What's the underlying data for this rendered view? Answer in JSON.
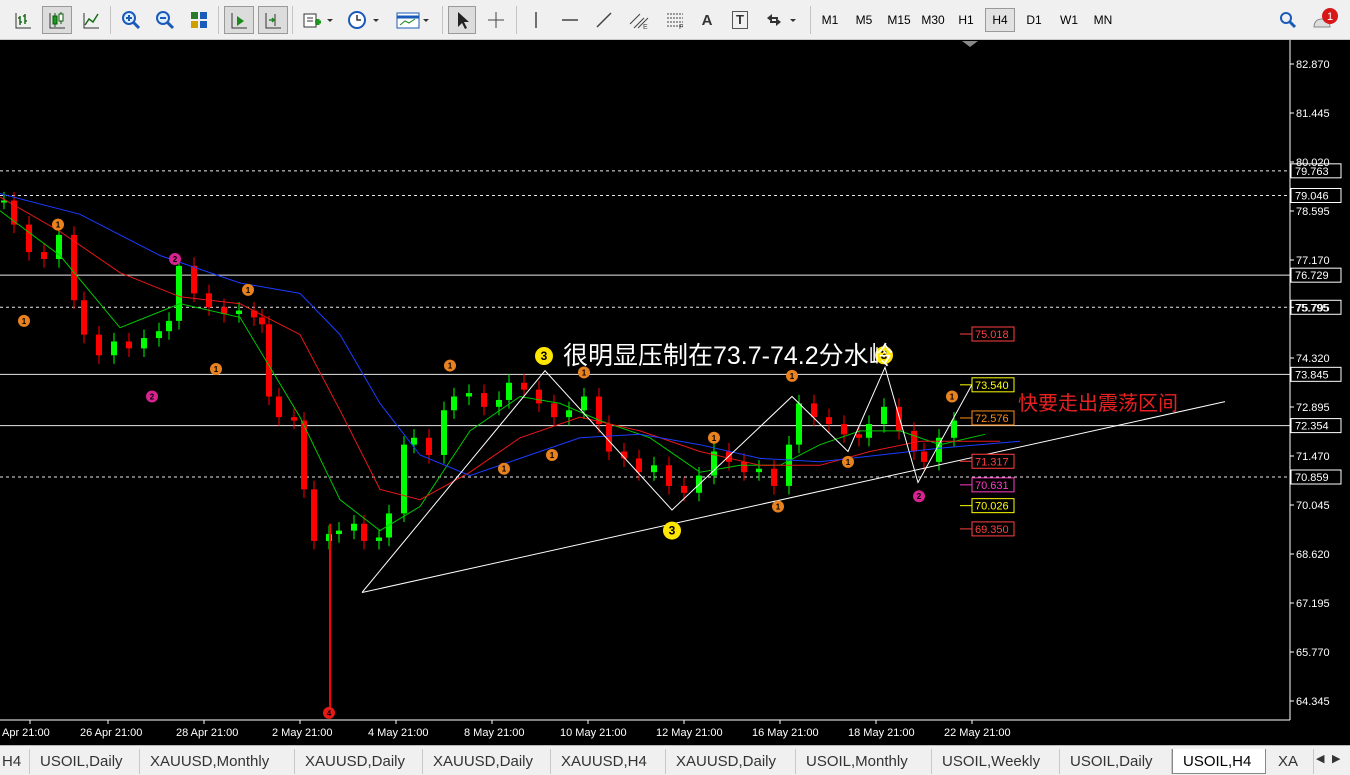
{
  "toolbar": {
    "tools": [
      "bar-chart-icon",
      "candlestick-icon",
      "line-chart-icon",
      "zoom-in-icon",
      "zoom-out-icon",
      "tile-windows-icon",
      "auto-scroll-icon",
      "chart-shift-icon",
      "indicators-icon",
      "periodicity-clock-icon",
      "templates-icon",
      "cursor-icon",
      "crosshair-icon",
      "vertical-line-icon",
      "horizontal-line-icon",
      "trendline-icon",
      "equidistant-channel-icon",
      "fibonacci-icon",
      "text-tool-icon",
      "text-label-icon",
      "arrows-icon"
    ],
    "text_tool": "A",
    "label_tool": "T",
    "timeframes": [
      "M1",
      "M5",
      "M15",
      "M30",
      "H1",
      "H4",
      "D1",
      "W1",
      "MN"
    ],
    "active_timeframe": "H4",
    "notification_count": "1"
  },
  "chart": {
    "price_axis": [
      "82.870",
      "81.445",
      "80.020",
      "78.595",
      "77.170",
      "75.795",
      "74.320",
      "72.895",
      "71.470",
      "70.045",
      "68.620",
      "67.195",
      "65.770",
      "64.345"
    ],
    "time_axis": [
      "Apr 21:00",
      "26 Apr 21:00",
      "28 Apr 21:00",
      "2 May 21:00",
      "4 May 21:00",
      "8 May 21:00",
      "10 May 21:00",
      "12 May 21:00",
      "16 May 21:00",
      "18 May 21:00",
      "22 May 21:00"
    ],
    "level_labels": [
      "79.763",
      "79.046",
      "76.729",
      "75.795",
      "73.845",
      "72.354",
      "70.859"
    ],
    "annotation_main": "很明显压制在73.7-74.2分水岭",
    "annotation_right": "快要走出震荡区间",
    "target_labels": [
      {
        "text": "75.018",
        "color": "#ff4040"
      },
      {
        "text": "73.540",
        "color": "#ffff00"
      },
      {
        "text": "72.576",
        "color": "#ff8c1a"
      },
      {
        "text": "71.317",
        "color": "#ff4040"
      },
      {
        "text": "70.631",
        "color": "#ff3cc8"
      },
      {
        "text": "70.026",
        "color": "#ffff00"
      },
      {
        "text": "69.350",
        "color": "#ff4040"
      }
    ],
    "wave_markers": [
      {
        "label": "1",
        "color": "#e8821e"
      },
      {
        "label": "2",
        "color": "#d6238f"
      },
      {
        "label": "3",
        "color": "#ffe600"
      },
      {
        "label": "4",
        "color": "#e81818"
      }
    ],
    "colors": {
      "up_candle": "#00ff00",
      "down_candle": "#ff0000",
      "ma_fast": "#00c800",
      "ma_mid": "#e81818",
      "ma_slow": "#1a3cff",
      "lines": "#ffffff"
    }
  },
  "tabs": {
    "items": [
      "H4",
      "USOIL,Daily",
      "XAUUSD,Monthly",
      "XAUUSD,Daily",
      "XAUUSD,Daily",
      "XAUUSD,H4",
      "XAUUSD,Daily",
      "USOIL,Monthly",
      "USOIL,Weekly",
      "USOIL,Daily",
      "USOIL,H4",
      "XA"
    ],
    "active": "USOIL,H4"
  }
}
